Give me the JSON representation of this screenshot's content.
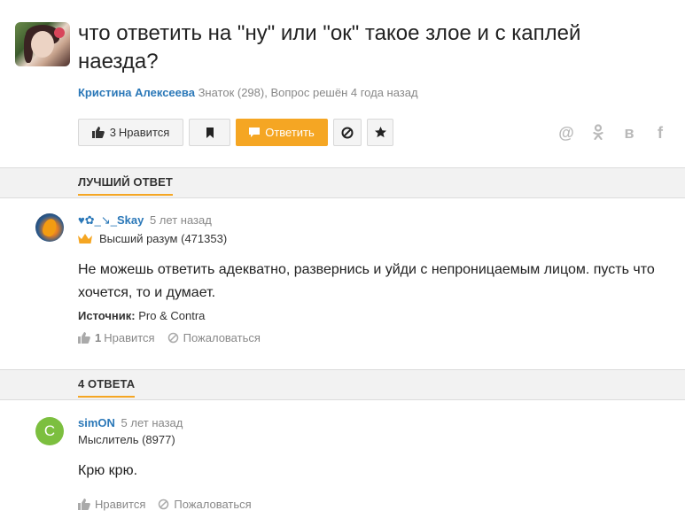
{
  "question": {
    "title": "что ответить на \"ну\" или \"ок\" такое злое и с каплей наезда?",
    "author": "Кристина Алексеева",
    "meta": "Знаток (298), Вопрос решён 4 года назад",
    "buttons": {
      "like_count": "3",
      "like_label": "Нравится",
      "answer_label": "Ответить"
    },
    "share": {
      "at": "@",
      "ok": "ok-icon",
      "vk": "в",
      "fb": "f"
    }
  },
  "best_answer": {
    "section_label": "ЛУЧШИЙ ОТВЕТ",
    "author_deco": "♥✿_↘_",
    "author": "Skay",
    "time": "5 лет назад",
    "rank": "Высший разум (471353)",
    "text": "Не можешь ответить адекватно, развернись и уйди с непроницаемым лицом. пусть что хочется, то и думает.",
    "source_label": "Источник:",
    "source": "Pro & Contra",
    "like_count": "1",
    "like_label": "Нравится",
    "report_label": "Пожаловаться"
  },
  "answers": {
    "section_label": "4 ОТВЕТА",
    "items": [
      {
        "avatar_letter": "С",
        "author": "simON",
        "time": "5 лет назад",
        "rank": "Мыслитель (8977)",
        "text": "Крю крю.",
        "like_label": "Нравится",
        "report_label": "Пожаловаться"
      }
    ]
  },
  "colors": {
    "accent": "#f5a623",
    "link": "#2b78b8",
    "avatar_green": "#7cbf3f"
  }
}
